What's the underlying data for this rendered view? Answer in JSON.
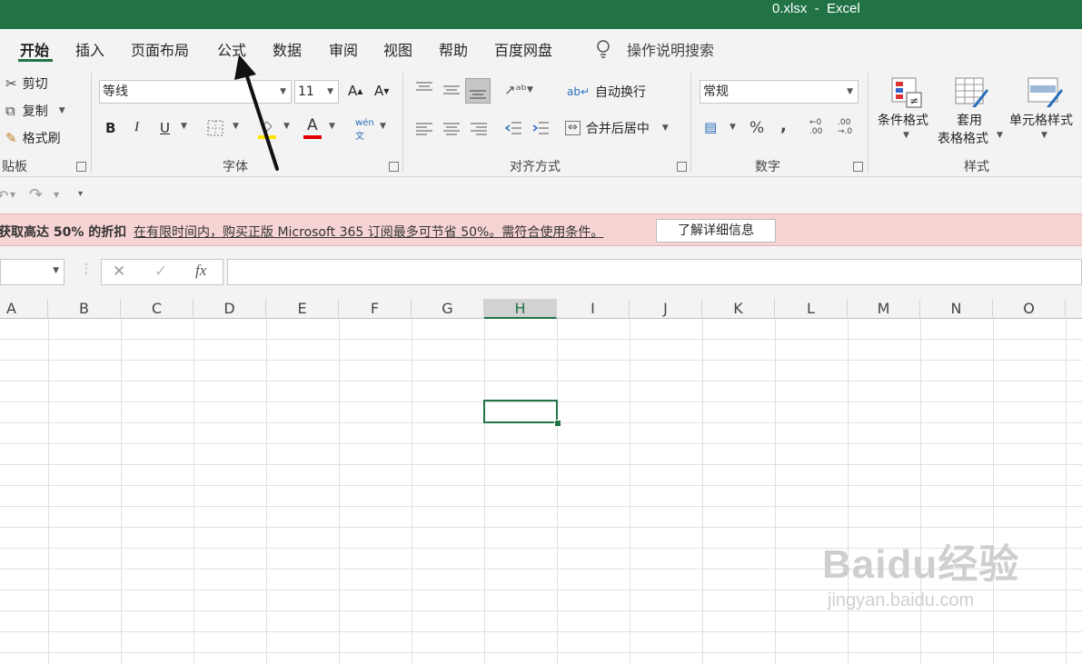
{
  "window": {
    "title": "0.xlsx  -  Excel"
  },
  "tabs": [
    "开始",
    "插入",
    "页面布局",
    "公式",
    "数据",
    "审阅",
    "视图",
    "帮助",
    "百度网盘"
  ],
  "tell_me": "操作说明搜索",
  "clipboard": {
    "cut": "剪切",
    "copy": "复制",
    "format_painter": "格式刷",
    "label": "贴板"
  },
  "font": {
    "name": "等线",
    "size": "11",
    "label": "字体"
  },
  "alignment": {
    "wrap_text": "自动换行",
    "merge_center": "合并后居中",
    "label": "对齐方式"
  },
  "number": {
    "format": "常规",
    "label": "数字"
  },
  "styles": {
    "conditional": "条件格式",
    "table_format_line1": "套用",
    "table_format_line2": "表格格式",
    "cell_styles": "单元格样式",
    "label": "样式"
  },
  "notice": {
    "bold": "获取高达 50% 的折扣",
    "message": "在有限时间内，购买正版 Microsoft 365 订阅最多可节省 50%。需符合使用条件。",
    "button": "了解详细信息"
  },
  "formula_bar": {
    "fx": "fx"
  },
  "columns": [
    "A",
    "B",
    "C",
    "D",
    "E",
    "F",
    "G",
    "H",
    "I",
    "J",
    "K",
    "L",
    "M",
    "N",
    "O"
  ],
  "selected_column": "H",
  "watermark": {
    "brand": "Baidu经验",
    "url": "jingyan.baidu.com"
  },
  "colors": {
    "accent": "#217346",
    "notice_bg": "#f7d4d4"
  }
}
